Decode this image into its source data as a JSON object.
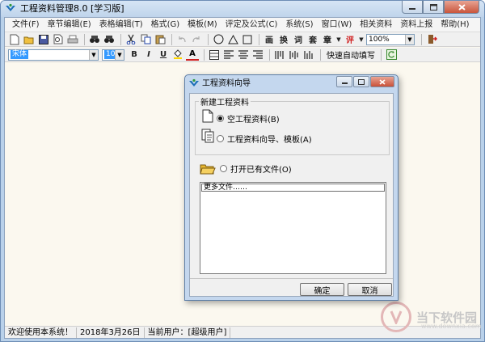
{
  "window": {
    "title": "工程资料管理8.0 [学习版]"
  },
  "menu": [
    "文件(F)",
    "章节编辑(E)",
    "表格编辑(T)",
    "格式(G)",
    "模板(M)",
    "评定及公式(C)",
    "系统(S)",
    "窗口(W)",
    "相关资料",
    "资料上报",
    "帮助(H)"
  ],
  "toolbar1": {
    "text_buttons": [
      "画",
      "换",
      "词",
      "套",
      "章",
      "评"
    ],
    "zoom_value": "100%"
  },
  "toolbar2": {
    "font_name": "宋体",
    "font_size": "10",
    "bold": "B",
    "italic": "I",
    "underline": "U",
    "font_color": "A",
    "auto_fill_label": "快速自动填写"
  },
  "status": {
    "welcome": "欢迎使用本系统！",
    "date": "2018年3月26日",
    "current_user": "当前用户：[超级用户]"
  },
  "dialog": {
    "title": "工程资料向导",
    "group_label": "新建工程资料",
    "option_empty": "空工程资料(B)",
    "option_wizard": "工程资料向导、模板(A)",
    "option_open": "打开已有文件(O)",
    "files_item": "更多文件……",
    "ok": "确定",
    "cancel": "取消"
  },
  "watermark": {
    "text": "当下软件园",
    "url": "www.downxia.com"
  },
  "colors": {
    "titlebar": "#bfd4eb",
    "workspace": "#fbf8ef",
    "dialog_frame": "#c4d7ee",
    "close_button": "#c9553c"
  }
}
